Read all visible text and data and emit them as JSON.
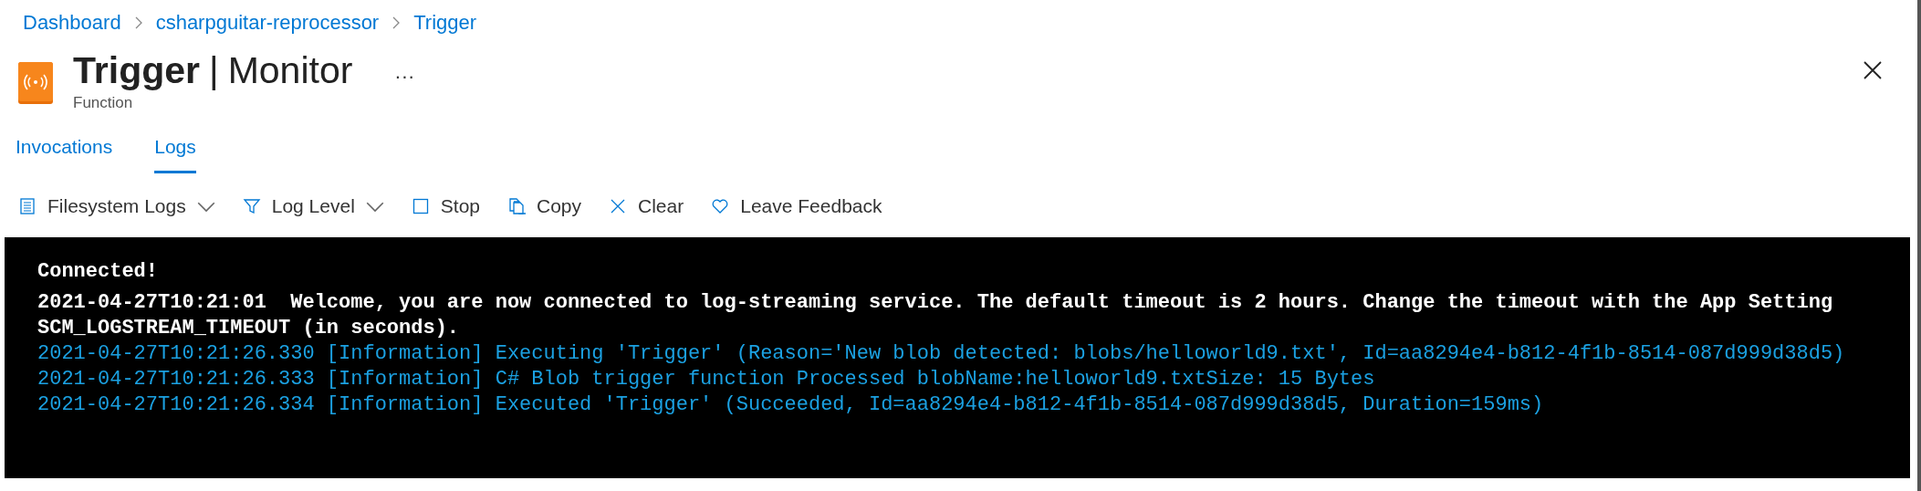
{
  "breadcrumb": [
    "Dashboard",
    "csharpguitar-reprocessor",
    "Trigger"
  ],
  "header": {
    "title": "Trigger",
    "subtitle_separator": "|",
    "subtitle": "Monitor",
    "more": "···",
    "type": "Function"
  },
  "tabs": [
    {
      "label": "Invocations",
      "selected": false
    },
    {
      "label": "Logs",
      "selected": true
    }
  ],
  "toolbar": [
    {
      "label": "Filesystem Logs",
      "kind": "list",
      "dropdown": true
    },
    {
      "label": "Log Level",
      "kind": "filter",
      "dropdown": true
    },
    {
      "label": "Stop",
      "kind": "stop",
      "dropdown": false
    },
    {
      "label": "Copy",
      "kind": "copy",
      "dropdown": false
    },
    {
      "label": "Clear",
      "kind": "clear",
      "dropdown": false
    },
    {
      "label": "Leave Feedback",
      "kind": "heart",
      "dropdown": false
    }
  ],
  "console": {
    "lines": [
      {
        "kind": "system",
        "text": "Connected!"
      },
      {
        "kind": "system",
        "text": "2021-04-27T10:21:01  Welcome, you are now connected to log-streaming service. The default timeout is 2 hours. Change the timeout with the App Setting SCM_LOGSTREAM_TIMEOUT (in seconds)."
      },
      {
        "kind": "info",
        "text": "2021-04-27T10:21:26.330 [Information] Executing 'Trigger' (Reason='New blob detected: blobs/helloworld9.txt', Id=aa8294e4-b812-4f1b-8514-087d999d38d5)"
      },
      {
        "kind": "info",
        "text": "2021-04-27T10:21:26.333 [Information] C# Blob trigger function Processed blobName:helloworld9.txtSize: 15 Bytes"
      },
      {
        "kind": "info",
        "text": "2021-04-27T10:21:26.334 [Information] Executed 'Trigger' (Succeeded, Id=aa8294e4-b812-4f1b-8514-087d999d38d5, Duration=159ms)"
      }
    ]
  }
}
